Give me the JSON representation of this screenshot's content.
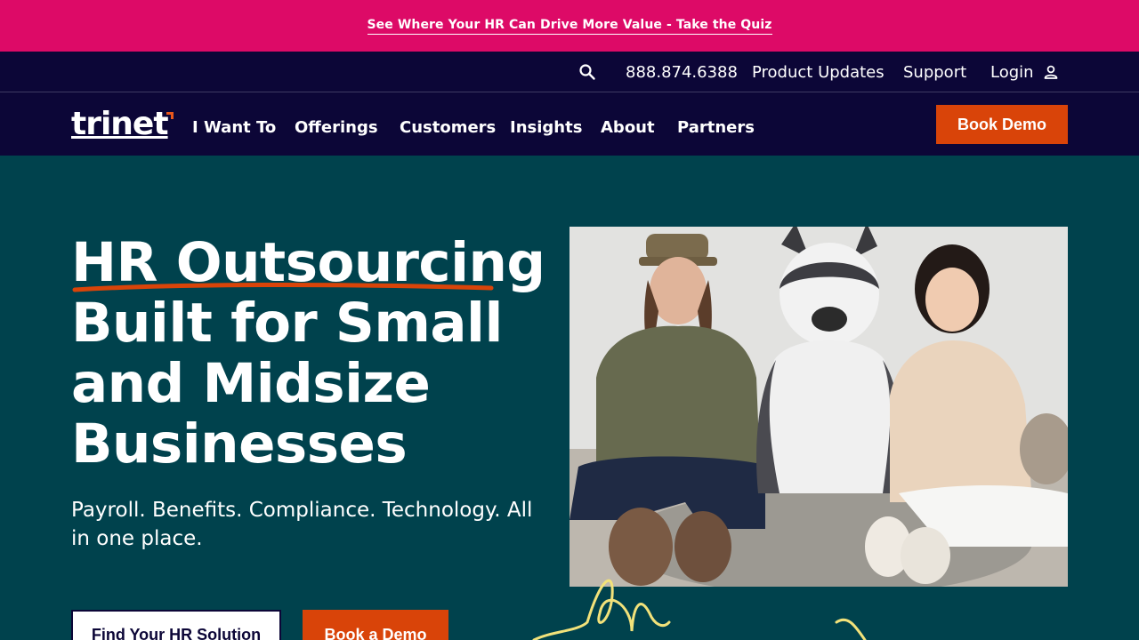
{
  "promo": {
    "text": "See Where Your HR Can Drive More Value - Take the Quiz"
  },
  "utility": {
    "phone": "888.874.6388",
    "product_updates": "Product Updates",
    "support": "Support",
    "login": "Login"
  },
  "nav": {
    "logo": "trinet",
    "items": [
      "I Want To",
      "Offerings",
      "Customers",
      "Insights",
      "About",
      "Partners"
    ],
    "cta": "Book Demo"
  },
  "hero": {
    "title_lines": [
      "HR Outsourcing",
      "Built for Small",
      "and Midsize",
      "Businesses"
    ],
    "subtitle": "Payroll. Benefits. Compliance. Technology. All in one place.",
    "primary_cta": "Find Your HR Solution",
    "secondary_cta": "Book a Demo"
  },
  "colors": {
    "promo_bg": "#dd0a67",
    "nav_bg": "#0c0637",
    "hero_bg": "#00424d",
    "accent_orange": "#d94409",
    "scribble_yellow": "#f2e27a"
  },
  "icons": {
    "search": "search-icon",
    "user": "user-icon"
  }
}
